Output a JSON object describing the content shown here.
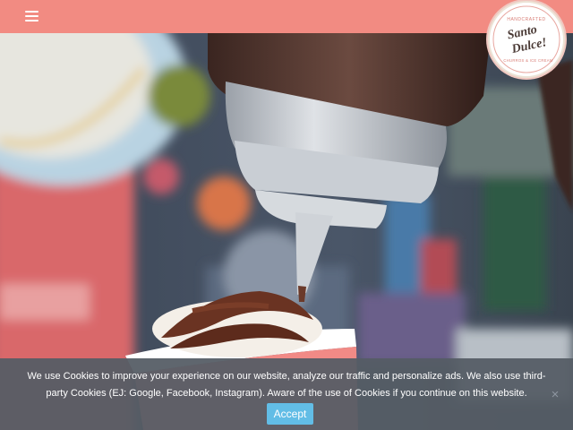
{
  "header": {
    "menu_icon": "hamburger-menu-icon",
    "background_color": "#f28b82"
  },
  "logo": {
    "small_top_text": "HANDCRAFTED",
    "main_text_1": "Santo",
    "main_text_2": "Dulce!",
    "small_bottom_text": "CHURROS & ICE CREAM"
  },
  "hero": {
    "subject": "chocolate sauce being squeezed onto ice cream"
  },
  "cookie_banner": {
    "message": "We use Cookies to improve your experience on our website, analyze our traffic and personalize ads. We also use third-party Cookies (EJ: Google, Facebook, Instagram). Aware of the use of Cookies if you continue on this website.",
    "accept_label": "Accept",
    "close_label": "×",
    "accept_color": "#62bde6"
  }
}
